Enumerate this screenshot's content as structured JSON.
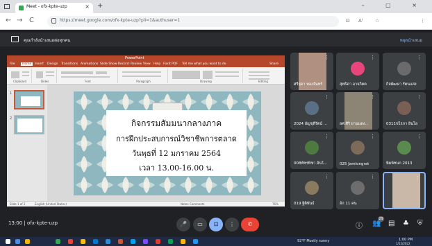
{
  "browser": {
    "tab_title": "Meet - ofx-kpte-uzp",
    "close_glyph": "×",
    "new_tab_glyph": "+",
    "window_controls": "– ▢ ×",
    "nav": {
      "back": "←",
      "forward": "→",
      "reload": "C",
      "home": "⌂"
    },
    "url": "https://meet.google.com/ofx-kpte-uzp?pli=1&authuser=1",
    "right_icons": [
      "⊡",
      "A⁾",
      "☆",
      "⋮"
    ]
  },
  "meet": {
    "presenting_text": "คุณกำลังนำเสนอต่อทุกคน",
    "stop_presenting": "หยุดนำเสนอ",
    "meeting_time": "13:00",
    "meeting_separator": "|",
    "meeting_code": "ofx-kpte-uzp",
    "participant_count": "29",
    "controls": {
      "mic": "🎤",
      "camera": "▭",
      "present": "⊡",
      "more": "⋮",
      "end": "✆"
    },
    "right_controls": [
      "ⓘ",
      "👥",
      "▤",
      "♣",
      "⛨"
    ]
  },
  "powerpoint": {
    "title": "PowerPoint",
    "tabs": [
      "File",
      "Home",
      "Insert",
      "Design",
      "Transitions",
      "Animations",
      "Slide Show",
      "Record",
      "Review",
      "View",
      "Help",
      "Foxit PDF",
      "Tell me what you want to do",
      "Share"
    ],
    "ribbon_groups": [
      "Clipboard",
      "Slides",
      "Font",
      "Paragraph",
      "Drawing",
      "Editing"
    ],
    "slide_numbers": [
      "1",
      "2"
    ],
    "slide_lines": [
      "กิจกรรมสัมมนากลางภาค",
      "การฝึกประสบการณ์วิชาชีพการตลาด",
      "วันพุธที่ 12 มกราคม 2564",
      "เวลา 13.00-16.00 น."
    ],
    "status_left": "Slide 1 of 2",
    "status_lang": "English (United States)",
    "status_right": "Notes  Comments",
    "zoom": "76%"
  },
  "participants": [
    {
      "name": "ศรีสุดา ทองจันทร์",
      "type": "camera",
      "color": "#b09080"
    },
    {
      "name": "สุทธิดา อาจกิตต",
      "type": "avatar",
      "color": "#e8467b",
      "letter": ""
    },
    {
      "name": "กิจพัฒนา รัตนแสง",
      "type": "photo",
      "color": "#6b6b6b"
    },
    {
      "name": "2024 อัญชุลีรัตน์ ...",
      "type": "photo",
      "color": "#5a6e86"
    },
    {
      "name": "ยศ.ศิริ ยานแดง...",
      "type": "camera",
      "color": "#8c8474"
    },
    {
      "name": "0311ชไรภา อินโอ",
      "type": "photo",
      "color": "#7a5f55"
    },
    {
      "name": "008พัชรพิชา อันโ...",
      "type": "photo",
      "color": "#4f7a3f"
    },
    {
      "name": "025 Jamlongrat",
      "type": "photo",
      "color": "#7d6b5a"
    },
    {
      "name": "พิมพ์ชนก 2013",
      "type": "photo",
      "color": "#5b8a4f"
    },
    {
      "name": "019 ฐิติพันธ์",
      "type": "photo",
      "color": "#8a7a60"
    },
    {
      "name": "อ้ก 11 คน",
      "type": "group",
      "color": "#6d6d6d"
    },
    {
      "name": "",
      "type": "self",
      "color": "#c9b8a8"
    }
  ],
  "taskbar": {
    "weather": "92°F  Mostly sunny",
    "time": "1:00 PM",
    "date": "1/12/2022",
    "icon_colors": [
      "#ffffff",
      "#4a90e2",
      "#f4b400",
      "#34a853",
      "#ea4335",
      "#fbbc04",
      "#0078d4",
      "#2f8dd8",
      "#c55a3a",
      "#00a1f1",
      "#7c4dff",
      "#e53935",
      "#0f9d58",
      "#ffb900",
      "#2196f3"
    ]
  }
}
